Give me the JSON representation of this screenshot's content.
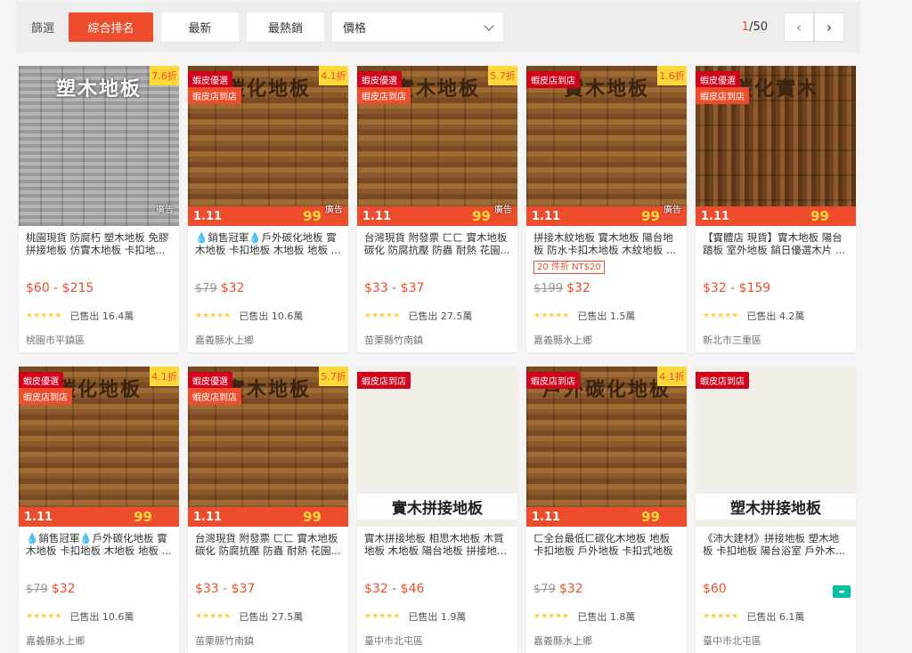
{
  "sortbar": {
    "label": "篩選",
    "buttons": [
      "綜合排名",
      "最新",
      "最熱銷"
    ],
    "price_select": "價格",
    "pager": {
      "current": "1",
      "total": "/50",
      "prev": "‹",
      "next": "›"
    }
  },
  "products": [
    {
      "title": "桃園現貨 防腐朽 塑木地板 免膠拼接地板 仿實木地板 卡扣地...",
      "old_price": "",
      "price": "$60 - $215",
      "tag": "",
      "sold": "已售出 16.4萬",
      "location": "桃園市平鎮區",
      "discount": "7.6折",
      "mall": "",
      "mall2": "",
      "ad": "廣告",
      "img_title": "塑木地板",
      "img_style": "grey",
      "promo": false
    },
    {
      "title": "💧銷售冠軍💧戶外碳化地板 實木地板 卡扣地板 木地板 地板 ...",
      "old_price": "$79",
      "price": "$32",
      "tag": "",
      "sold": "已售出 10.6萬",
      "location": "嘉義縣水上鄉",
      "discount": "4.1折",
      "mall": "蝦皮優選",
      "mall2": "蝦皮店到店",
      "ad": "廣告",
      "img_title": "碳化地板",
      "img_style": "wood",
      "promo": true
    },
    {
      "title": "台灣現貨 附發票 ㄈㄈ 實木地板 碳化 防腐抗壓 防蟲 耐熱 花園...",
      "old_price": "",
      "price": "$33 - $37",
      "tag": "",
      "sold": "已售出 27.5萬",
      "location": "苗栗縣竹南鎮",
      "discount": "5.7折",
      "mall": "蝦皮優選",
      "mall2": "蝦皮店到店",
      "ad": "廣告",
      "img_title": "實木地板",
      "img_style": "wood",
      "promo": true
    },
    {
      "title": "拼接木紋地板 實木地板 陽台地板 防水卡扣木地板 木紋地板 ...",
      "old_price": "$199",
      "price": "$32",
      "tag": "20 件折 NT$20",
      "sold": "已售出 1.5萬",
      "location": "嘉義縣水上鄉",
      "discount": "1.6折",
      "mall": "蝦皮店到店",
      "mall2": "",
      "ad": "廣告",
      "img_title": "實木地板",
      "img_style": "wood",
      "promo": true
    },
    {
      "title": "【實體店 現貨】實木地板 陽台踏板 室外地板 銷日優選木片 ...",
      "old_price": "",
      "price": "$32 - $159",
      "tag": "",
      "sold": "已售出 4.2萬",
      "location": "新北市三重區",
      "discount": "",
      "mall": "蝦皮優選",
      "mall2": "蝦皮店到店",
      "ad": "",
      "img_title": "碳化實木",
      "img_style": "wood2",
      "promo": true
    },
    {
      "title": "💧銷售冠軍💧戶外碳化地板 實木地板 卡扣地板 木地板 地板 ...",
      "old_price": "$79",
      "price": "$32",
      "tag": "",
      "sold": "已售出 10.6萬",
      "location": "嘉義縣水上鄉",
      "discount": "4.1折",
      "mall": "蝦皮優選",
      "mall2": "蝦皮店到店",
      "ad": "",
      "img_title": "碳化地板",
      "img_style": "wood",
      "promo": true
    },
    {
      "title": "台灣現貨 附發票 ㄈㄈ 實木地板 碳化 防腐抗壓 防蟲 耐熱 花園...",
      "old_price": "",
      "price": "$33 - $37",
      "tag": "",
      "sold": "已售出 27.5萬",
      "location": "苗栗縣竹南鎮",
      "discount": "5.7折",
      "mall": "蝦皮優選",
      "mall2": "蝦皮店到店",
      "ad": "",
      "img_title": "實木地板",
      "img_style": "wood",
      "promo": true
    },
    {
      "title": "實木拼接地板 相思木地板 木質地板 木地板 陽台地板 拼接地...",
      "old_price": "",
      "price": "$32 - $46",
      "tag": "",
      "sold": "已售出 1.9萬",
      "location": "臺中市北屯區",
      "discount": "",
      "mall": "蝦皮店到店",
      "mall2": "",
      "ad": "",
      "img_title": "實木拼接地板",
      "img_style": "light",
      "promo": false
    },
    {
      "title": "ㄈ全台最低ㄈ碳化木地板 地板 卡扣地板 戶外地板 卡扣式地板 陽臺...",
      "old_price": "$79",
      "price": "$32",
      "tag": "",
      "sold": "已售出 1.8萬",
      "location": "嘉義縣水上鄉",
      "discount": "4.1折",
      "mall": "蝦皮店到店",
      "mall2": "",
      "ad": "",
      "img_title": "戶外碳化地板",
      "img_style": "wood",
      "promo": true
    },
    {
      "title": "《沛大建材》拼接地板 塑木地板 卡扣地板 陽台浴室 戶外木...",
      "old_price": "",
      "price": "$60",
      "tag": "",
      "sold": "已售出 6.1萬",
      "location": "臺中市北屯區",
      "discount": "",
      "mall": "蝦皮店到店",
      "mall2": "",
      "ad": "",
      "img_title": "塑木拼接地板",
      "img_style": "light",
      "promo": false
    }
  ],
  "promo_strip": {
    "left": "1.11",
    "right": "99"
  },
  "stars": "★★★★★",
  "icons": {
    "prev": "chevron-left-icon",
    "next": "chevron-right-icon",
    "dropdown": "chevron-down-icon",
    "free_shipping": "free-shipping-icon"
  },
  "colors": {
    "accent": "#ee4d2d",
    "badge_yellow": "#ffd839",
    "star": "#ffce3d"
  }
}
